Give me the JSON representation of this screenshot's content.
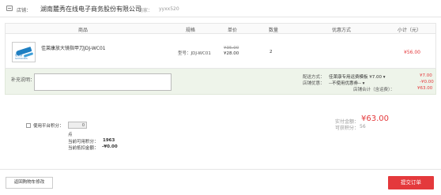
{
  "store": {
    "label": "店铺：",
    "name": "湖南麓秀在线电子商务股份有限公司",
    "seller_label": "商家：",
    "seller_name": "yyxx520"
  },
  "table": {
    "headers": [
      "商品",
      "规格",
      "单价",
      "数量",
      "优惠方式",
      "小计（元）"
    ]
  },
  "item": {
    "thumb_text": "佳莱康 SCISSORS",
    "name": "佳莱康放大镜指甲刀JDJ-WC01",
    "spec": "型号：JDJ-WC01",
    "original_price": "¥35.00",
    "price": "¥28.00",
    "quantity": "2",
    "subtotal": "¥56.00"
  },
  "remark": {
    "label": "补充说明：",
    "delivery_label": "配送方式：",
    "delivery_value": "佳莱康专用运费模板 ¥7.00 ▾",
    "delivery_amount": "¥7.00",
    "discount_label": "店铺优惠：",
    "discount_value": "--不使用优惠券-- ▾",
    "discount_amount": "-¥0.00",
    "total_label": "店铺合计（含运费）：",
    "total_amount": "¥63.00"
  },
  "points": {
    "use_label": "使用平台积分：",
    "input_value": "0",
    "unit": "点",
    "available_label": "当前可用积分：",
    "available_value": "1963",
    "deduct_label": "当前抵扣金额：",
    "deduct_value": "-¥0.00"
  },
  "summary": {
    "paid_label": "实付金额：",
    "paid_value": "¥63.00",
    "earn_label": "可获积分：",
    "earn_value": "56"
  },
  "actions": {
    "back_label": "返回购物车修改",
    "submit_label": "提交订单"
  },
  "colors": {
    "accent": "#e4393c",
    "remark_bg": "#eef4ea"
  }
}
